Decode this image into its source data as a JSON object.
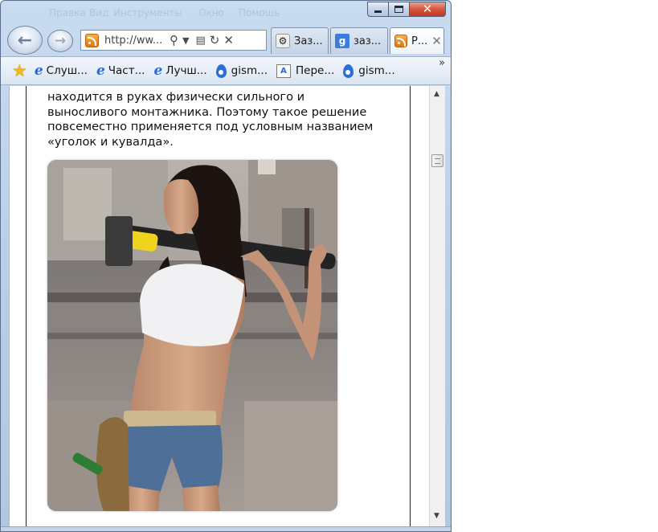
{
  "window": {
    "menu_items": [
      "Правка",
      "Вид",
      "Инструменты",
      "Окно",
      "Помощь"
    ]
  },
  "nav": {
    "address": "http://ww..."
  },
  "tabs": [
    {
      "label": "Заз...",
      "icon": "gear-icon"
    },
    {
      "label": "заз...",
      "icon": "google-icon"
    },
    {
      "label": "Р...",
      "icon": "rss-icon"
    }
  ],
  "favorites": {
    "items": [
      {
        "label": "Слуш...",
        "icon": "ie-icon"
      },
      {
        "label": "Част...",
        "icon": "ie-icon"
      },
      {
        "label": "Лучш...",
        "icon": "ie-icon"
      },
      {
        "label": "gism...",
        "icon": "drop-icon"
      },
      {
        "label": "Пере...",
        "icon": "translate-icon"
      },
      {
        "label": "gism...",
        "icon": "drop-icon"
      }
    ],
    "more": "»"
  },
  "article": {
    "lines": [
      "находится в руках физически сильного и",
      "выносливого монтажника. Поэтому такое решение",
      "повсеместно применяется под условным названием",
      "«уголок и кувалда»."
    ]
  },
  "colors": {
    "close_button": "#d6553c",
    "frame": "#b7cde6"
  }
}
